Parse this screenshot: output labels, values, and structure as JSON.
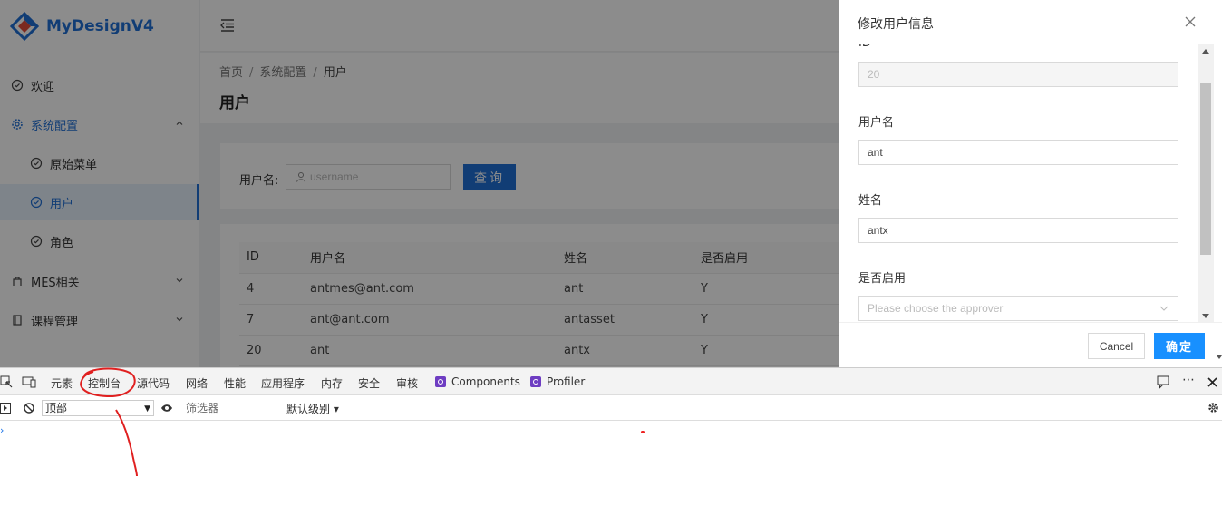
{
  "app": {
    "logo_text": "MyDesignV4"
  },
  "sidebar": {
    "items": [
      {
        "label": "欢迎",
        "icon": "check-circle-icon"
      },
      {
        "label": "系统配置",
        "icon": "gear-icon"
      },
      {
        "label": "原始菜单",
        "icon": "check-circle-icon"
      },
      {
        "label": "用户",
        "icon": "check-circle-icon"
      },
      {
        "label": "角色",
        "icon": "check-circle-icon"
      },
      {
        "label": "MES相关",
        "icon": "user-icon"
      },
      {
        "label": "课程管理",
        "icon": "book-icon"
      }
    ],
    "active_color": "#1f6fd6"
  },
  "breadcrumb": {
    "items": [
      "首页",
      "系统配置",
      "用户"
    ]
  },
  "page": {
    "title": "用户"
  },
  "search": {
    "label": "用户名:",
    "placeholder": "username",
    "button": "查询"
  },
  "table": {
    "columns": [
      "ID",
      "用户名",
      "姓名",
      "是否启用"
    ],
    "rows": [
      [
        "4",
        "antmes@ant.com",
        "ant",
        "Y"
      ],
      [
        "7",
        "ant@ant.com",
        "antasset",
        "Y"
      ],
      [
        "20",
        "ant",
        "antx",
        "Y"
      ]
    ]
  },
  "drawer": {
    "title": "修改用户信息",
    "cut_label": "ID",
    "id_value": "20",
    "username_label": "用户名",
    "username_value": "ant",
    "name_label": "姓名",
    "name_value": "antx",
    "enabled_label": "是否启用",
    "enabled_placeholder": "Please choose the approver",
    "cancel": "Cancel",
    "ok": "确定"
  },
  "devtools": {
    "tabs": [
      "元素",
      "控制台",
      "源代码",
      "网络",
      "性能",
      "应用程序",
      "内存",
      "安全",
      "审核",
      "Components",
      "Profiler"
    ],
    "context": "顶部",
    "filter_placeholder": "筛选器",
    "level": "默认级别"
  },
  "colors": {
    "primary": "#1f6fd6",
    "ok_button": "#1890ff",
    "annotation": "#e02020"
  }
}
